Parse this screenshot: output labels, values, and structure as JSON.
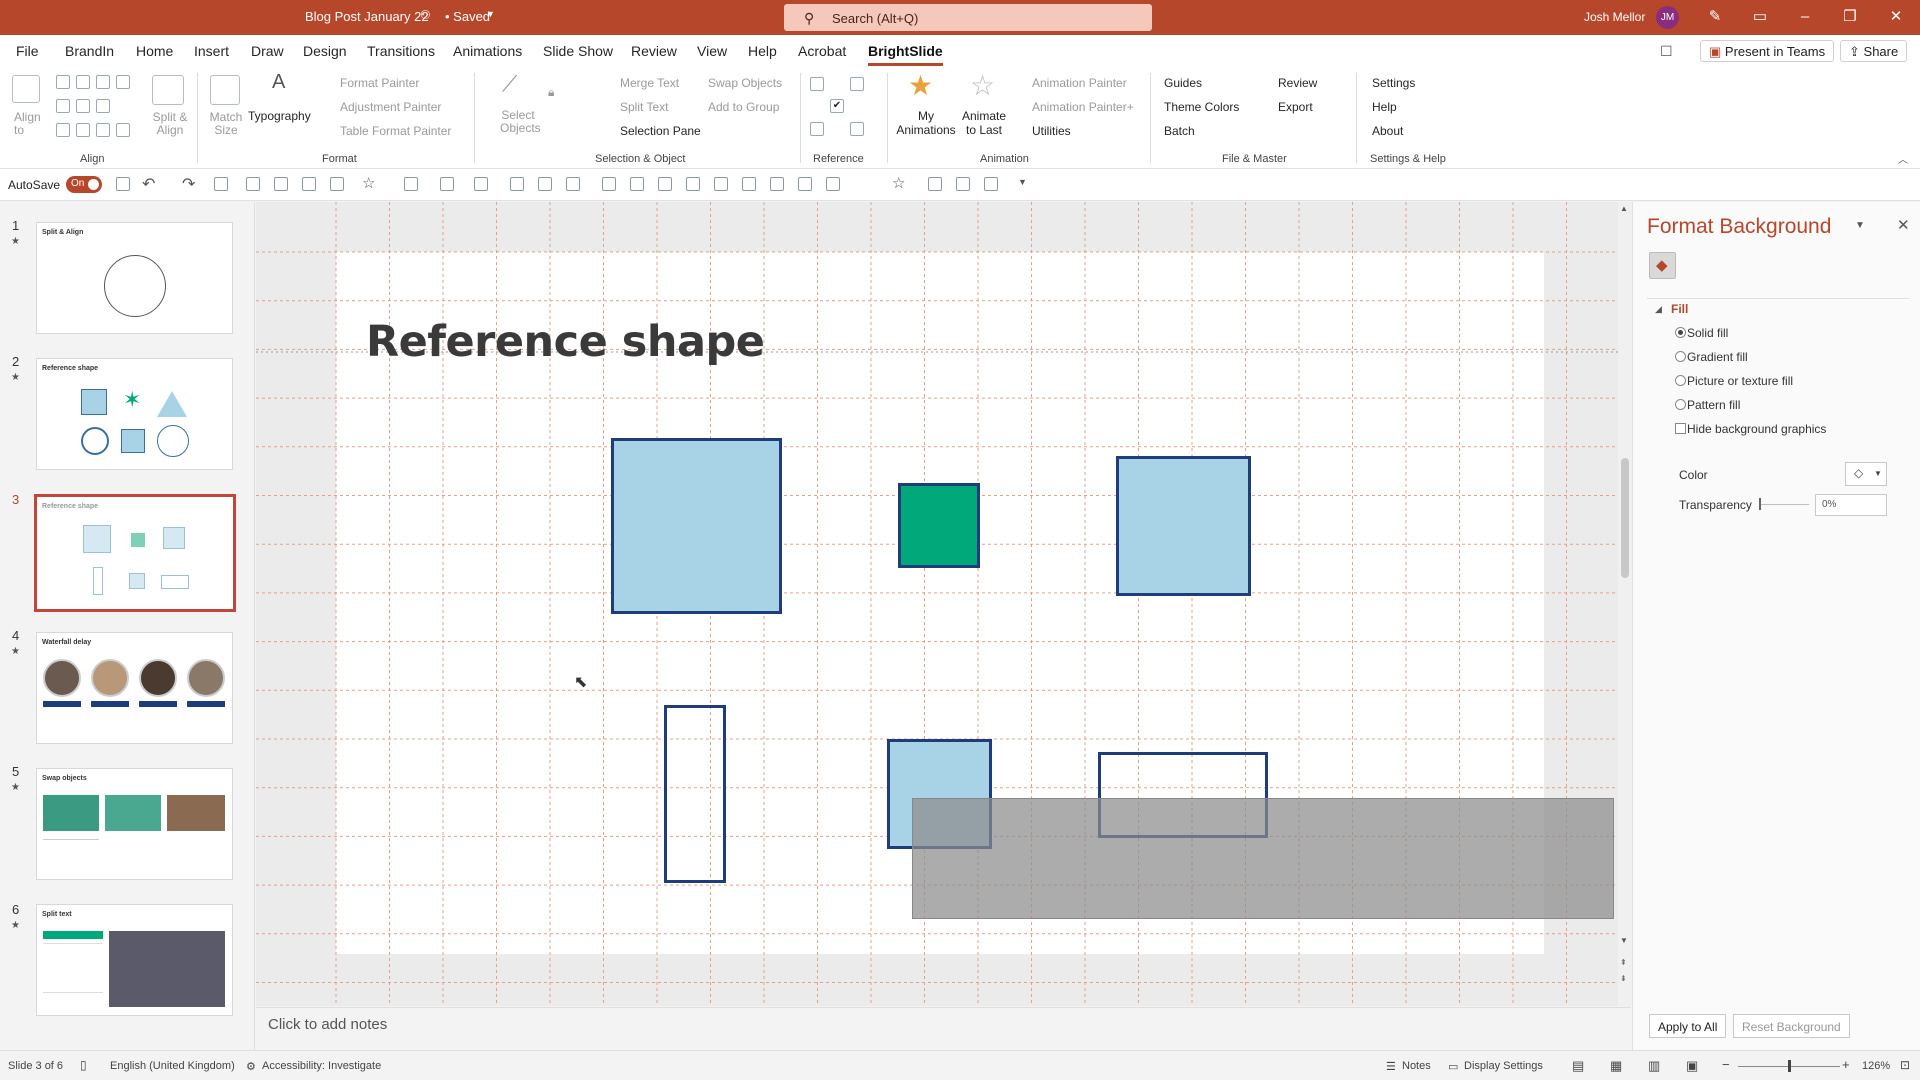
{
  "titlebar": {
    "doc_name": "Blog Post January 22",
    "saved": "• Saved",
    "search_placeholder": "Search (Alt+Q)",
    "user": "Josh Mellor",
    "initials": "JM"
  },
  "tabs": [
    "File",
    "BrandIn",
    "Home",
    "Insert",
    "Draw",
    "Design",
    "Transitions",
    "Animations",
    "Slide Show",
    "Review",
    "View",
    "Help",
    "Acrobat",
    "BrightSlide"
  ],
  "tabs_right": {
    "present": "Present in Teams",
    "share": "Share"
  },
  "ribbon": {
    "align": {
      "align_to": "Align to",
      "split_align": "Split & Align",
      "group": "Align"
    },
    "format": {
      "match_size": "Match Size",
      "typography": "Typography",
      "format_painter": "Format Painter",
      "adjustment_painter": "Adjustment Painter",
      "table_format_painter": "Table Format Painter",
      "group": "Format"
    },
    "selection": {
      "select_objects": "Select Objects",
      "merge_text": "Merge Text",
      "split_text": "Split Text",
      "swap_objects": "Swap Objects",
      "add_to_group": "Add to Group",
      "selection_pane": "Selection Pane",
      "group": "Selection & Object"
    },
    "reference": {
      "group": "Reference"
    },
    "animation": {
      "my_animations": "My Animations",
      "animate_to_last": "Animate to Last",
      "animation_painter": "Animation Painter",
      "animation_painter_plus": "Animation Painter+",
      "utilities": "Utilities",
      "group": "Animation"
    },
    "file_master": {
      "guides": "Guides",
      "theme_colors": "Theme Colors",
      "batch": "Batch",
      "review": "Review",
      "export": "Export",
      "group": "File & Master"
    },
    "settings_help": {
      "settings": "Settings",
      "help": "Help",
      "about": "About",
      "group": "Settings & Help"
    }
  },
  "qat": {
    "autosave": "AutoSave",
    "toggle": "On"
  },
  "slides": [
    {
      "num": "1",
      "title": "Split & Align"
    },
    {
      "num": "2",
      "title": "Reference shape"
    },
    {
      "num": "3",
      "title": "Reference shape"
    },
    {
      "num": "4",
      "title": "Waterfall delay"
    },
    {
      "num": "5",
      "title": "Swap objects"
    },
    {
      "num": "6",
      "title": "Split text"
    }
  ],
  "slide": {
    "title": "Reference shape"
  },
  "notes": {
    "placeholder": "Click to add notes"
  },
  "format_pane": {
    "title": "Format Background",
    "section": "Fill",
    "options": [
      "Solid fill",
      "Gradient fill",
      "Picture or texture fill",
      "Pattern fill"
    ],
    "hide_bg": "Hide background graphics",
    "color_label": "Color",
    "transparency_label": "Transparency",
    "transparency_value": "0%",
    "apply_all": "Apply to All",
    "reset": "Reset Background"
  },
  "statusbar": {
    "slide": "Slide 3 of 6",
    "language": "English (United Kingdom)",
    "accessibility": "Accessibility: Investigate",
    "notes": "Notes",
    "display": "Display Settings",
    "zoom": "126%"
  },
  "colors": {
    "accent": "#b7472a",
    "shape_fill": "#a8d3e6",
    "shape_stroke": "#1f3d7a",
    "green": "#00a87a"
  }
}
